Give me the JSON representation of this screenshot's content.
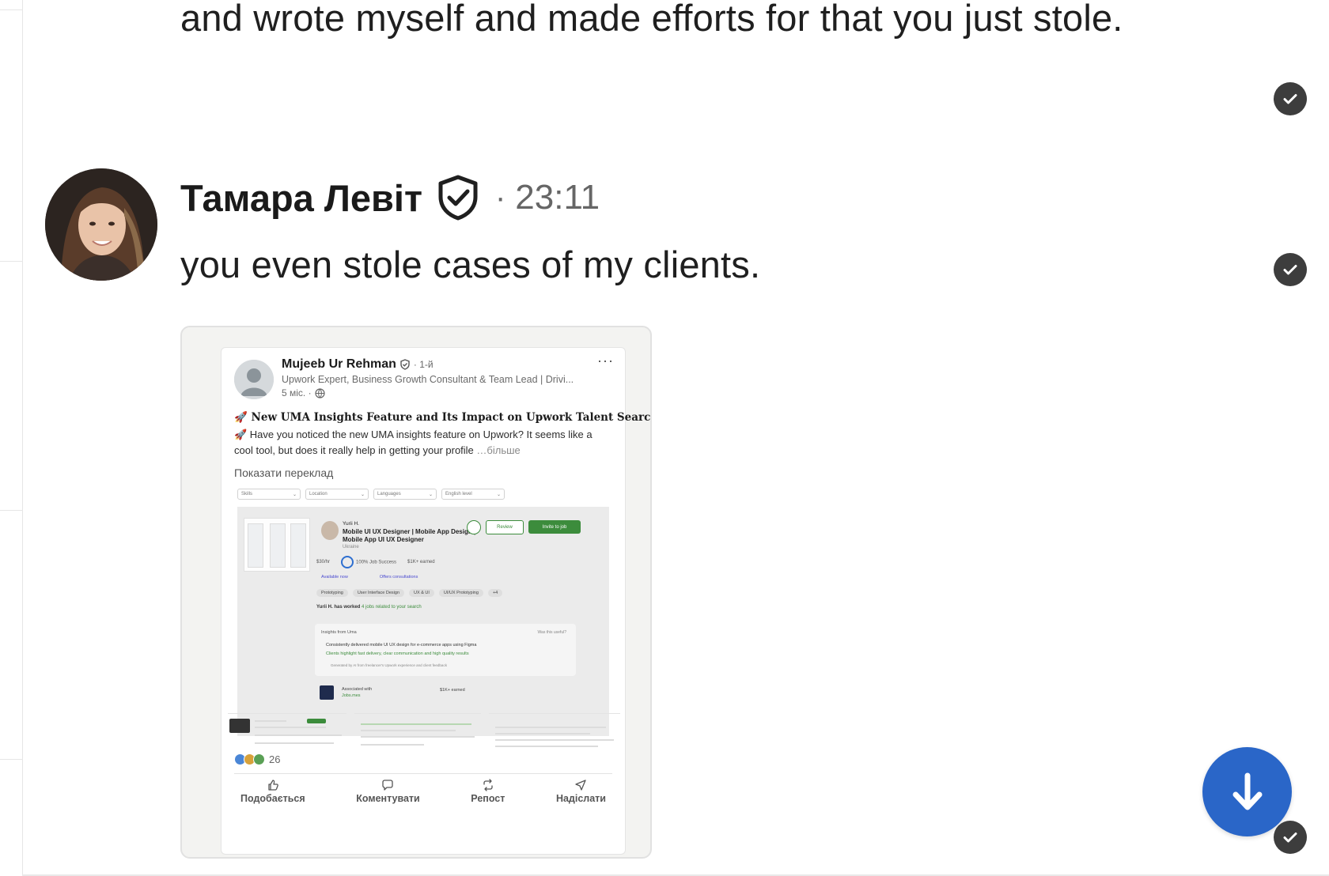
{
  "conversation": {
    "messages": [
      {
        "text": "and wrote myself and made efforts for that you just stole."
      },
      {
        "sender": "Тамара Левіт",
        "separator": "·",
        "time": "23:11",
        "text": "you even stole cases of my clients."
      }
    ]
  },
  "attachment": {
    "post": {
      "author": "Mujeeb Ur Rehman",
      "degree": "· 1-й",
      "headline": "Upwork Expert, Business Growth Consultant & Team Lead | Drivi...",
      "age": "5 міс. ·",
      "menu": "···",
      "title": "🚀 New UMA Insights Feature and Its Impact on Upwork Talent Search",
      "body": "🚀 Have you noticed the new UMA insights feature on Upwork? It seems like a cool tool, but does it really help in getting your profile",
      "more": "…більше",
      "translate": "Показати переклад",
      "reactions_count": "26",
      "actions": {
        "like": "Подобається",
        "comment": "Коментувати",
        "repost": "Репост",
        "send": "Надіслати"
      }
    },
    "embedded_profile": {
      "filters": [
        "Skills",
        "Location",
        "Languages",
        "English level"
      ],
      "name": "Yurii H.",
      "title": "Mobile UI UX Designer | Mobile App Design | Mobile App UI UX Designer",
      "location": "Ukraine",
      "review_label": "Review",
      "invite_label": "Invite to job",
      "rate": "$30/hr",
      "job_success": "100% Job Success",
      "earned": "$1K+ earned",
      "available": "Available now",
      "consultations": "Offers consultations",
      "skills": [
        "Prototyping",
        "User Interface Design",
        "UX & UI",
        "UI/UX Prototyping",
        "+4"
      ],
      "worked_prefix": "Yurii H. has worked",
      "worked_link": "4 jobs related to your search",
      "insights_title": "Insights from Uma",
      "insights_feedback": "Was this useful?",
      "insight_1": "Consistently delivered mobile UI UX design for e-commerce apps using Figma",
      "insight_2": "Clients highlight fast delivery, clear communication and high quality results",
      "insights_footer": "Generated by AI from freelancer's Upwork experience and client feedback",
      "associated_label": "Associated with",
      "associated_link": "Jobs.mes",
      "associated_earned": "$1K+ earned"
    }
  },
  "colors": {
    "fab": "#2a66c8",
    "check": "#3d3d3d",
    "upwork_green": "#3c8c3c"
  },
  "icons": {
    "read_receipt": "check-circle-icon",
    "verified": "shield-check-icon",
    "scroll_down": "arrow-down-icon"
  }
}
